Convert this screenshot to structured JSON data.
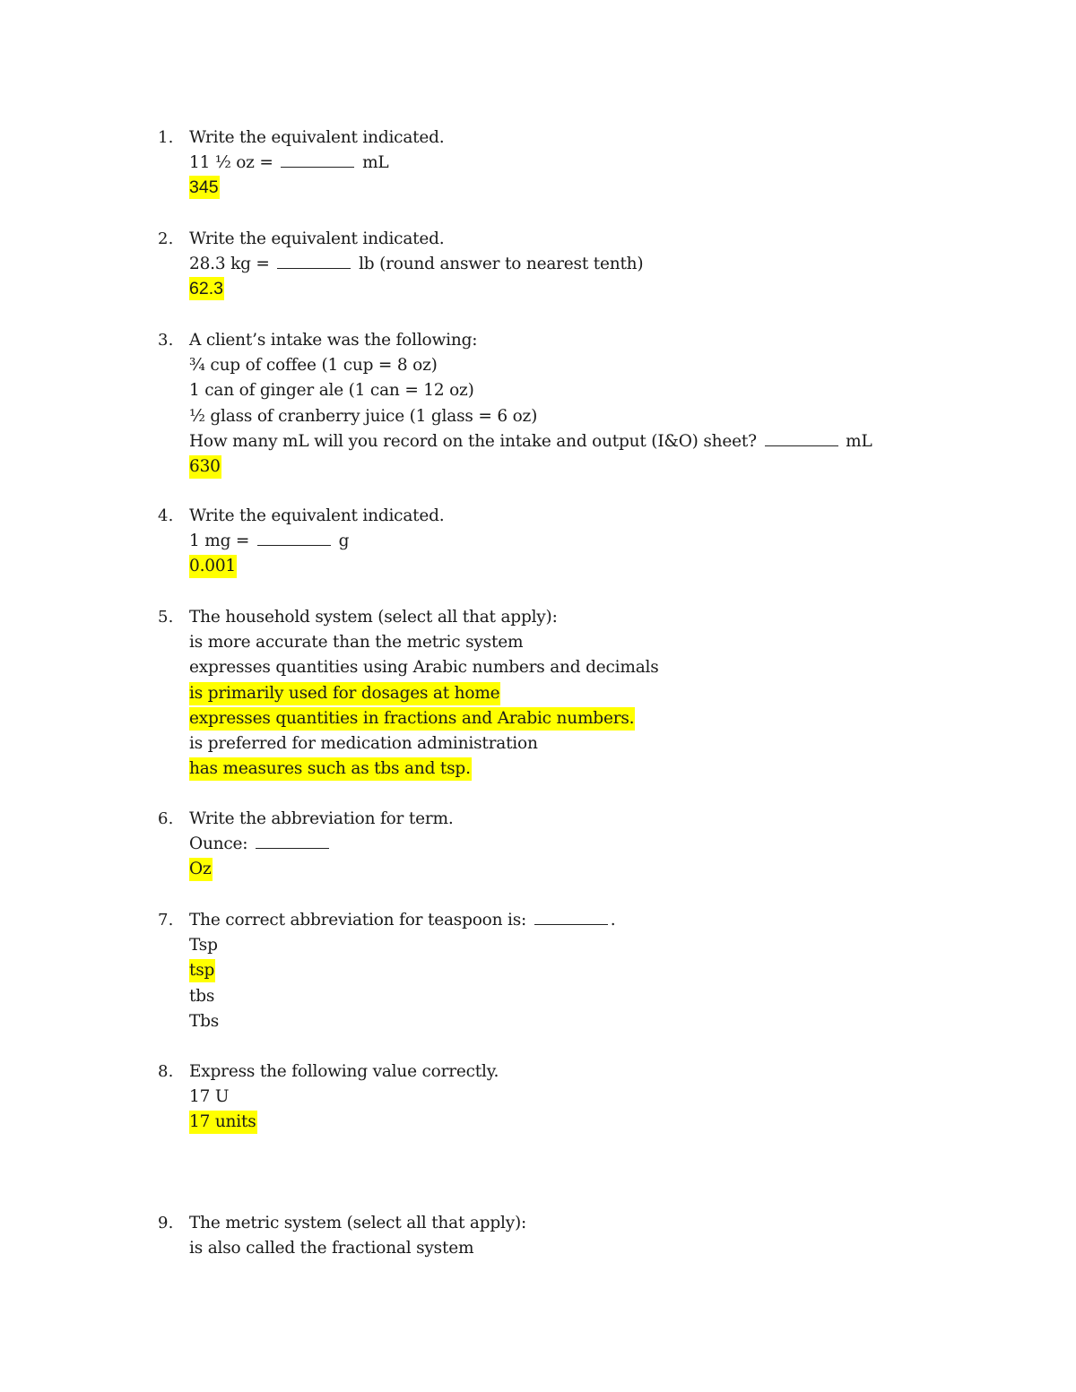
{
  "document": {
    "highlight_color": "#ffff00",
    "questions": [
      {
        "number": "1.",
        "prompt": "Write the equivalent indicated.",
        "lines": [
          {
            "before": "11 ½ oz = ",
            "after": " mL"
          }
        ],
        "answer": "345"
      },
      {
        "number": "2.",
        "prompt": "Write the equivalent indicated.",
        "lines": [
          {
            "before": "28.3 kg = ",
            "after": " lb (round answer to nearest tenth)"
          }
        ],
        "answer": "62.3"
      },
      {
        "number": "3.",
        "prompt": "A client’s intake was the following:",
        "items": [
          "¾ cup of coffee (1 cup = 8 oz)",
          "1 can of ginger ale (1 can = 12 oz)",
          "½ glass of cranberry juice (1 glass = 6 oz)"
        ],
        "lines": [
          {
            "before": "How many mL will you record on the intake and output (I&O) sheet? ",
            "after": " mL"
          }
        ],
        "answer": "630"
      },
      {
        "number": "4.",
        "prompt": "Write the equivalent indicated.",
        "lines": [
          {
            "before": "1 mg = ",
            "after": " g"
          }
        ],
        "answer": "0.001"
      },
      {
        "number": "5.",
        "prompt": "The household system (select all that apply):",
        "options": [
          {
            "text": "is more accurate than the metric system",
            "selected": false
          },
          {
            "text": "expresses quantities using Arabic numbers and decimals",
            "selected": false
          },
          {
            "text": "is primarily used for dosages at home",
            "selected": true
          },
          {
            "text": "expresses quantities in fractions and Arabic numbers.",
            "selected": true
          },
          {
            "text": "is preferred for medication administration",
            "selected": false
          },
          {
            "text": "has measures such as tbs and tsp.",
            "selected": true
          }
        ]
      },
      {
        "number": "6.",
        "prompt": "Write the abbreviation for term.",
        "lines": [
          {
            "before": "Ounce: ",
            "after": ""
          }
        ],
        "answer": "Oz"
      },
      {
        "number": "7.",
        "prompt_before": "The correct abbreviation for teaspoon is: ",
        "prompt_after": ".",
        "options": [
          {
            "text": "Tsp",
            "selected": false
          },
          {
            "text": "tsp",
            "selected": true
          },
          {
            "text": "tbs",
            "selected": false
          },
          {
            "text": "Tbs",
            "selected": false
          }
        ]
      },
      {
        "number": "8.",
        "prompt": "Express the following value correctly.",
        "given": "17 U",
        "answer": "17 units"
      },
      {
        "number": "9.",
        "prompt": "The metric system (select all that apply):",
        "options": [
          {
            "text": "is also called the fractional system",
            "selected": false
          }
        ]
      }
    ]
  }
}
